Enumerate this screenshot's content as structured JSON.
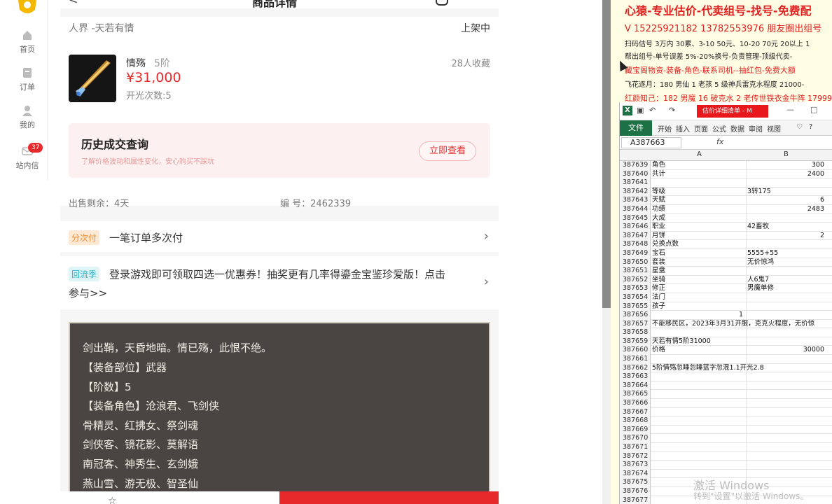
{
  "nav": {
    "items": [
      {
        "label": "首页",
        "icon": "home-icon"
      },
      {
        "label": "订单",
        "icon": "order-icon"
      },
      {
        "label": "我的",
        "icon": "user-icon"
      },
      {
        "label": "站内信",
        "icon": "mail-icon",
        "badge": "37"
      }
    ]
  },
  "header": {
    "title": "商品详情",
    "back": "<"
  },
  "product": {
    "server": "人界 -天若有情",
    "status": "上架中",
    "name": "情殇",
    "tier": "5阶",
    "price": "¥31,000",
    "opens": "开光次数:5",
    "favorites": "28人收藏"
  },
  "history": {
    "title": "历史成交查询",
    "subtitle": "了解价格波动和属性变化，安心购买不踩坑",
    "button": "立即查看"
  },
  "meta": {
    "remaining": "出售剩余：4天",
    "serial": "编 号：2462339"
  },
  "promo1": {
    "tag": "分次付",
    "text": "一笔订单多次付",
    "color": "#f08a2c"
  },
  "promo2": {
    "tag": "回流季",
    "text": "登录游戏即可领取四选一优惠券！抽奖更有几率得鎏金宝鉴珍爱版！点击",
    "text2": "参与>>",
    "color": "#2ab3c8"
  },
  "description": {
    "lines": [
      "剑出鞘，天昏地暗。情已殇，此恨不绝。",
      "【装备部位】武器",
      "【阶数】5",
      "【装备角色】沧浪君、飞剑侠",
      "骨精灵、红拂女、祭剑魂",
      "剑侠客、镜花影、莫解语",
      "南冠客、神秀生、玄剑娥",
      "燕山雪、游无极、智圣仙"
    ]
  },
  "right_panel": {
    "headline": "心猿-专业估价-代卖组号-找号-免费配",
    "phones": "V 15225921182   13782553976 朋友圈出组号",
    "line3": "扫码估号 3万内 30累、3-10 50元、10-20 70元 20以上 1",
    "line4": "帮出组号-单号误差 5%-20%换号-负责管理-顶级代卖-",
    "line5": "藏宝阁物资-装备-角色-联系司机--抽红包-免费大额",
    "line6": "飞花逐月：180 男仙 1 老孩 5 级神兵雷克水程度 21000-",
    "line7": "红颜知己：182 男魔 16 破克水 2 老传世铁衣金牛阵 17999-"
  },
  "excel": {
    "doc_title": "估价详细清单 - M",
    "file_tab": "文件",
    "tabs": [
      "开始",
      "插入",
      "页面",
      "公式",
      "数据",
      "审阅",
      "视图"
    ],
    "name_box": "A387663",
    "fx": "fx",
    "col_a": "A",
    "col_b": "B",
    "rows": [
      {
        "n": "387639",
        "a": "角色",
        "b": "",
        "br": "300"
      },
      {
        "n": "387640",
        "a": "共计",
        "b": "",
        "br": "2400"
      },
      {
        "n": "387641",
        "a": "",
        "b": "",
        "br": ""
      },
      {
        "n": "387642",
        "a": "等级",
        "b": "3转175",
        "br": ""
      },
      {
        "n": "387643",
        "a": "天赋",
        "b": "",
        "br": "6"
      },
      {
        "n": "387644",
        "a": "功绩",
        "b": "",
        "br": "2483"
      },
      {
        "n": "387645",
        "a": "大成",
        "b": "",
        "br": ""
      },
      {
        "n": "387646",
        "a": "职业",
        "b": "42畜牧",
        "br": ""
      },
      {
        "n": "387647",
        "a": "月饼",
        "b": "",
        "br": "2"
      },
      {
        "n": "387648",
        "a": "兑换点数",
        "b": "",
        "br": ""
      },
      {
        "n": "387649",
        "a": "宝石",
        "b": "5555+55",
        "br": ""
      },
      {
        "n": "387650",
        "a": "套装",
        "b": "无价惊鸿",
        "br": ""
      },
      {
        "n": "387651",
        "a": "星盘",
        "b": "",
        "br": ""
      },
      {
        "n": "387652",
        "a": "坐骑",
        "b": "人6鬼7",
        "br": ""
      },
      {
        "n": "387653",
        "a": "修正",
        "b": "男魔单修",
        "br": ""
      },
      {
        "n": "387654",
        "a": "法门",
        "b": "",
        "br": ""
      },
      {
        "n": "387655",
        "a": "孩子",
        "b": "",
        "br": ""
      },
      {
        "n": "387656",
        "a": "",
        "b": "",
        "br": "",
        "mid": "1"
      },
      {
        "n": "387657",
        "a": "不能移民区，2023年3月31开服，克克火程度，无价惊",
        "b": "",
        "br": ""
      },
      {
        "n": "387658",
        "a": "",
        "b": "",
        "br": ""
      },
      {
        "n": "387659",
        "a": "天若有情5阶31000",
        "b": "",
        "br": ""
      },
      {
        "n": "387660",
        "a": "价格",
        "b": "",
        "br": "30000"
      },
      {
        "n": "387661",
        "a": "",
        "b": "",
        "br": ""
      },
      {
        "n": "387662",
        "a": "5阶情殇忽睡忽睡蓝字忽混1.1开光2.8",
        "b": "",
        "br": ""
      },
      {
        "n": "387663",
        "a": "",
        "b": "",
        "br": ""
      },
      {
        "n": "387664",
        "a": "",
        "b": "",
        "br": ""
      },
      {
        "n": "387665",
        "a": "",
        "b": "",
        "br": ""
      },
      {
        "n": "387666",
        "a": "",
        "b": "",
        "br": ""
      },
      {
        "n": "387667",
        "a": "",
        "b": "",
        "br": ""
      },
      {
        "n": "387668",
        "a": "",
        "b": "",
        "br": ""
      },
      {
        "n": "387669",
        "a": "",
        "b": "",
        "br": ""
      },
      {
        "n": "387670",
        "a": "",
        "b": "",
        "br": ""
      },
      {
        "n": "387671",
        "a": "",
        "b": "",
        "br": ""
      },
      {
        "n": "387672",
        "a": "",
        "b": "",
        "br": ""
      },
      {
        "n": "387673",
        "a": "",
        "b": "",
        "br": ""
      },
      {
        "n": "387674",
        "a": "",
        "b": "",
        "br": ""
      },
      {
        "n": "387675",
        "a": "",
        "b": "",
        "br": ""
      },
      {
        "n": "387676",
        "a": "",
        "b": "",
        "br": ""
      },
      {
        "n": "387677",
        "a": "",
        "b": "",
        "br": ""
      }
    ]
  },
  "watermark": {
    "line1": "激活 Windows",
    "line2": "转到\"设置\"以激活 Windows。"
  }
}
